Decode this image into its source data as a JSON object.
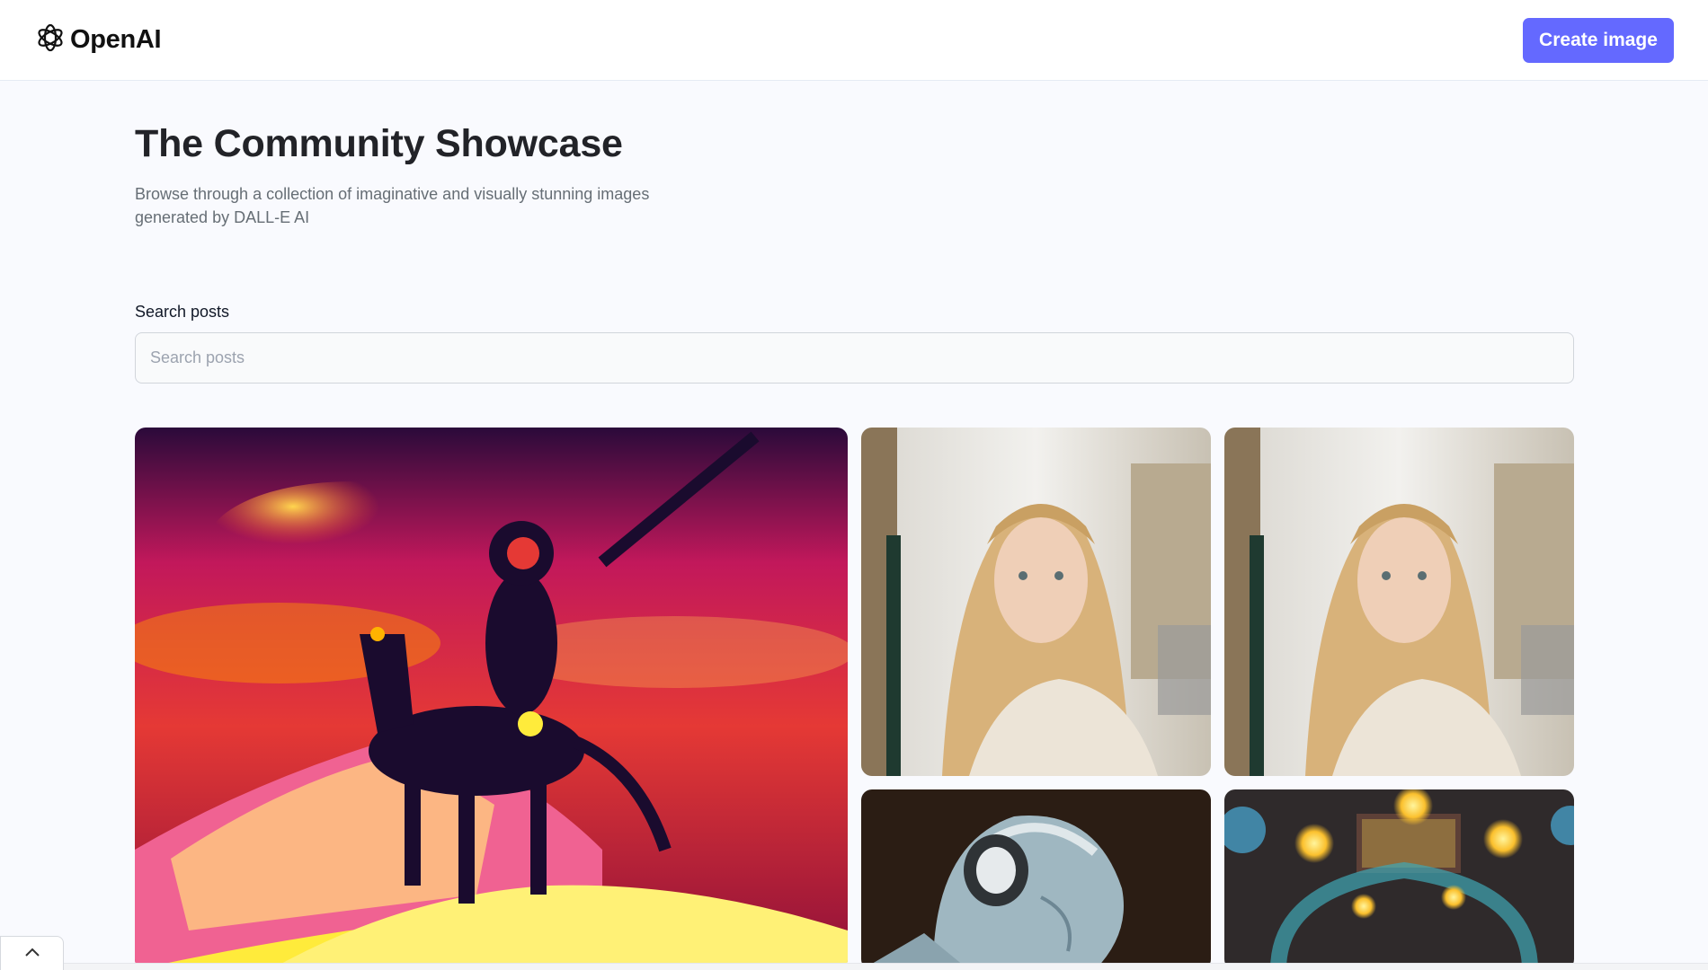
{
  "header": {
    "logo_text": "OpenAI",
    "logo_icon": "openai-logo-icon",
    "create_button_label": "Create image",
    "accent_color": "#6469ff"
  },
  "main": {
    "title": "The Community Showcase",
    "subtitle": "Browse through a collection of imaginative and visually stunning images generated by DALL-E AI",
    "search": {
      "label": "Search posts",
      "placeholder": "Search posts",
      "value": ""
    }
  },
  "gallery": {
    "cards": [
      {
        "subject": "red-knight-on-horse-image"
      },
      {
        "subject": "blonde-woman-portrait-image"
      },
      {
        "subject": "blonde-woman-portrait-image"
      },
      {
        "subject": "statue-with-headphones-image"
      },
      {
        "subject": "glowing-lanterns-room-image"
      }
    ]
  },
  "footer": {
    "scroll_icon": "chevron-up-icon"
  }
}
